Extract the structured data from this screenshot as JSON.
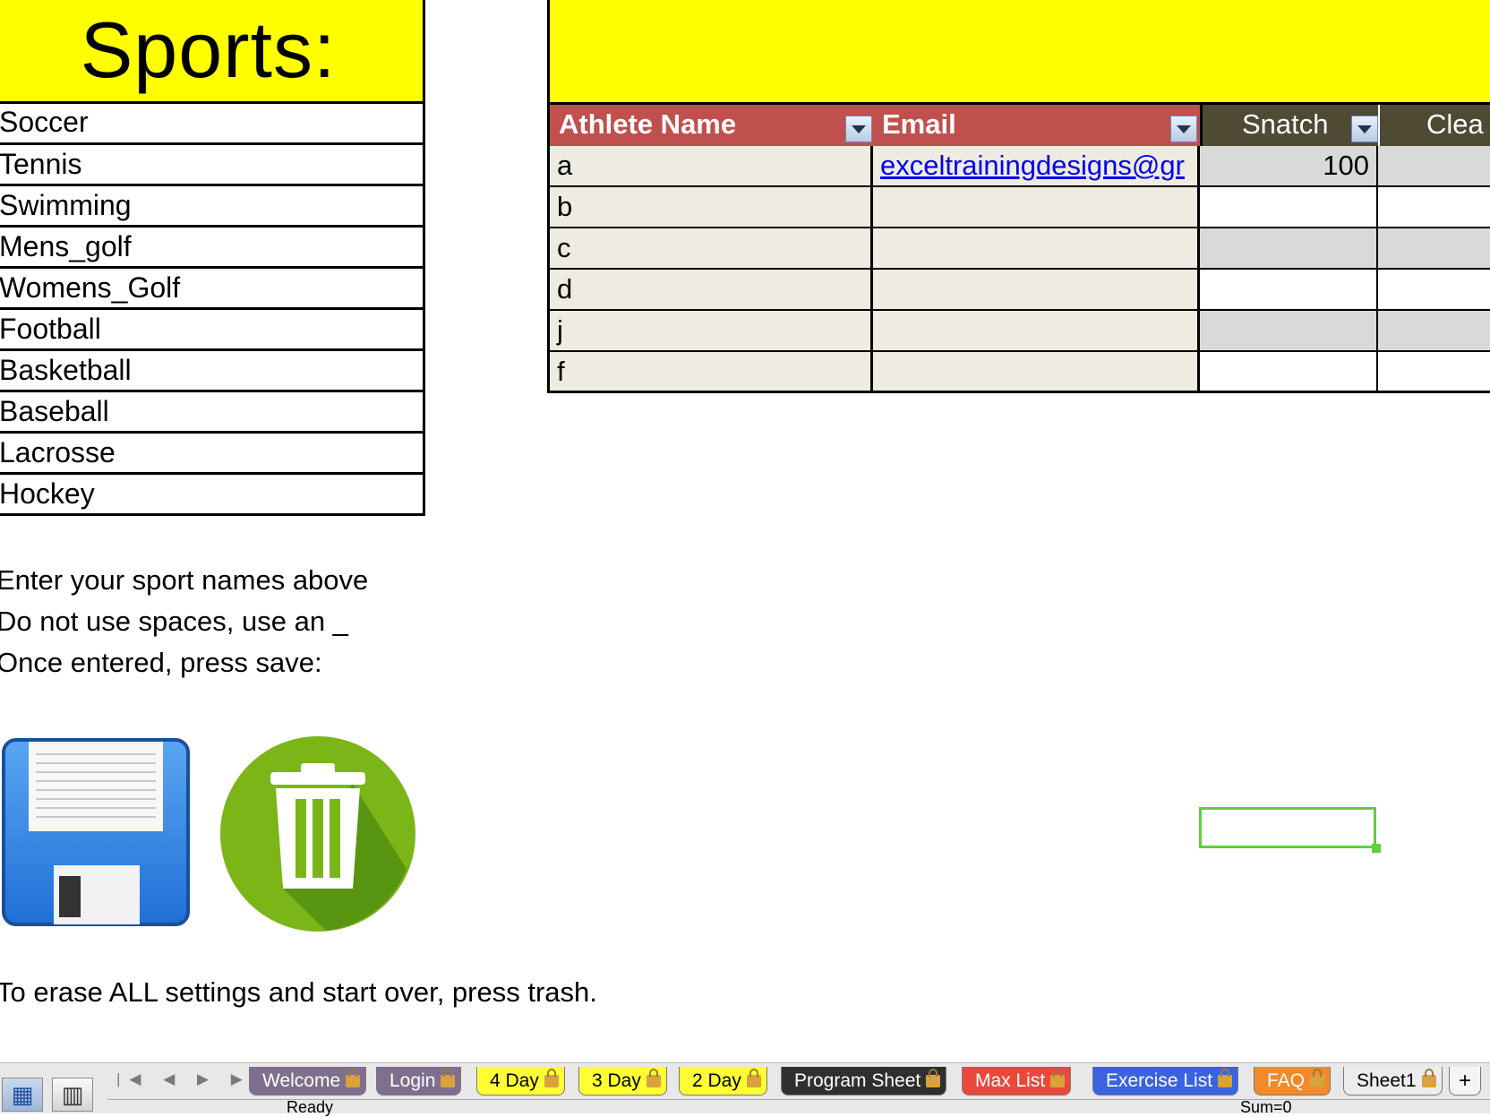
{
  "sports": {
    "title": "Sports:",
    "items": [
      "Soccer",
      "Tennis",
      "Swimming",
      "Mens_golf",
      "Womens_Golf",
      "Football",
      "Basketball",
      "Baseball",
      "Lacrosse",
      "Hockey"
    ]
  },
  "instructions": {
    "line1": "Enter your sport names above",
    "line2": "Do not use spaces, use an _",
    "line3": "Once entered, press save:",
    "erase": "To erase ALL settings and start over, press trash."
  },
  "icons": {
    "save": "floppy-disk-icon",
    "trash": "trash-icon"
  },
  "table": {
    "headers": {
      "name": "Athlete Name",
      "email": "Email",
      "snatch": "Snatch",
      "clean": "Clea"
    },
    "rows": [
      {
        "name": "a",
        "email": "exceltrainingdesigns@gr",
        "snatch": "100"
      },
      {
        "name": "b",
        "email": "",
        "snatch": ""
      },
      {
        "name": "c",
        "email": "",
        "snatch": ""
      },
      {
        "name": "d",
        "email": "",
        "snatch": ""
      },
      {
        "name": "j",
        "email": "",
        "snatch": ""
      },
      {
        "name": "f",
        "email": "",
        "snatch": ""
      }
    ]
  },
  "tabs": [
    {
      "label": "Welcome",
      "bg": "#7f6f8f",
      "fg": "#ffffff"
    },
    {
      "label": "Login",
      "bg": "#7f6f8f",
      "fg": "#ffffff"
    },
    {
      "label": "4 Day",
      "bg": "#ffff33",
      "fg": "#000000"
    },
    {
      "label": "3 Day",
      "bg": "#ffff33",
      "fg": "#000000"
    },
    {
      "label": "2 Day",
      "bg": "#ffff33",
      "fg": "#000000"
    },
    {
      "label": "Program Sheet",
      "bg": "#2f2f2f",
      "fg": "#ffffff"
    },
    {
      "label": "Max List",
      "bg": "#e8493a",
      "fg": "#ffffff"
    },
    {
      "label": "Exercise List",
      "bg": "#3a63e0",
      "fg": "#ffffff"
    },
    {
      "label": "FAQ",
      "bg": "#f28a2a",
      "fg": "#ffffff"
    },
    {
      "label": "Sheet1",
      "bg": "#ececec",
      "fg": "#000000"
    }
  ],
  "tab_add": "+",
  "status": {
    "ready": "Ready",
    "sum": "Sum=0"
  }
}
